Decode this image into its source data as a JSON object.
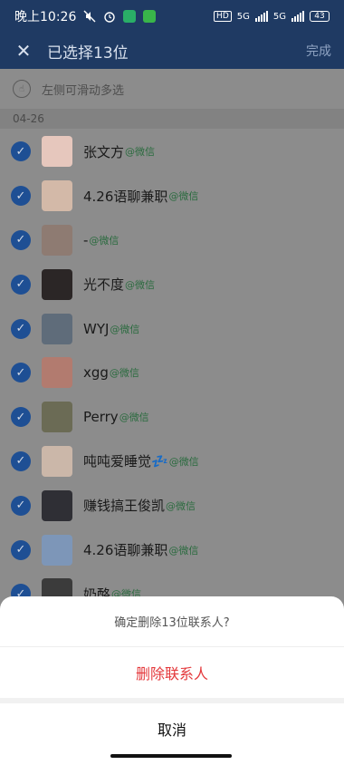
{
  "status": {
    "time": "晚上10:26",
    "network": "5G",
    "battery": "43"
  },
  "header": {
    "close_icon": "close-icon",
    "title": "已选择13位",
    "done": "完成"
  },
  "hint": "左侧可滑动多选",
  "date": "04-26",
  "contacts": [
    {
      "name": "张文方",
      "tag": "@微信",
      "avatar_color": "#e6c7bd"
    },
    {
      "name": "4.26语聊兼职",
      "tag": "@微信",
      "avatar_color": "#d3b9a8"
    },
    {
      "name": "-",
      "tag": "@微信",
      "avatar_color": "#8e7b72"
    },
    {
      "name": "光不度",
      "tag": "@微信",
      "avatar_color": "#2b2626"
    },
    {
      "name": "WYJ",
      "tag": "@微信",
      "avatar_color": "#5f6c7a"
    },
    {
      "name": "xgg",
      "tag": "@微信",
      "avatar_color": "#b27b6f"
    },
    {
      "name": "Perry",
      "tag": "@微信",
      "avatar_color": "#6b6b55"
    },
    {
      "name": "吨吨爱睡觉💤",
      "tag": "@微信",
      "avatar_color": "#cbb7a9"
    },
    {
      "name": "赚钱搞王俊凯",
      "tag": "@微信",
      "avatar_color": "#2f2f35"
    },
    {
      "name": "4.26语聊兼职",
      "tag": "@微信",
      "avatar_color": "#7d96b8"
    },
    {
      "name": "奶酪",
      "tag": "@微信",
      "avatar_color": "#3b3b3b"
    }
  ],
  "dialog": {
    "question": "确定删除13位联系人?",
    "delete": "删除联系人",
    "cancel": "取消"
  }
}
